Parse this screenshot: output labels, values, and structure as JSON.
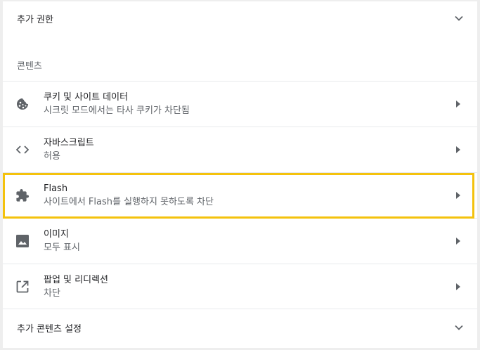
{
  "additional_permissions": {
    "label": "추가 권한",
    "icon": "chevron-down-icon"
  },
  "content_section": {
    "title": "콘텐츠"
  },
  "items": [
    {
      "title": "쿠키 및 사이트 데이터",
      "subtitle": "시크릿 모드에서는 타사 쿠키가 차단됨",
      "icon": "cookie-icon"
    },
    {
      "title": "자바스크립트",
      "subtitle": "허용",
      "icon": "code-brackets-icon"
    },
    {
      "title": "Flash",
      "subtitle": "사이트에서 Flash를 실행하지 못하도록 차단",
      "icon": "puzzle-piece-icon"
    },
    {
      "title": "이미지",
      "subtitle": "모두 표시",
      "icon": "image-icon"
    },
    {
      "title": "팝업 및 리디렉션",
      "subtitle": "차단",
      "icon": "open-in-new-icon"
    }
  ],
  "additional_content_settings": {
    "label": "추가 콘텐츠 설정",
    "icon": "chevron-down-icon"
  },
  "colors": {
    "highlight_border": "#f4c20d",
    "icon": "#5f6368",
    "text_primary": "#202124",
    "text_secondary": "#5f6368"
  }
}
